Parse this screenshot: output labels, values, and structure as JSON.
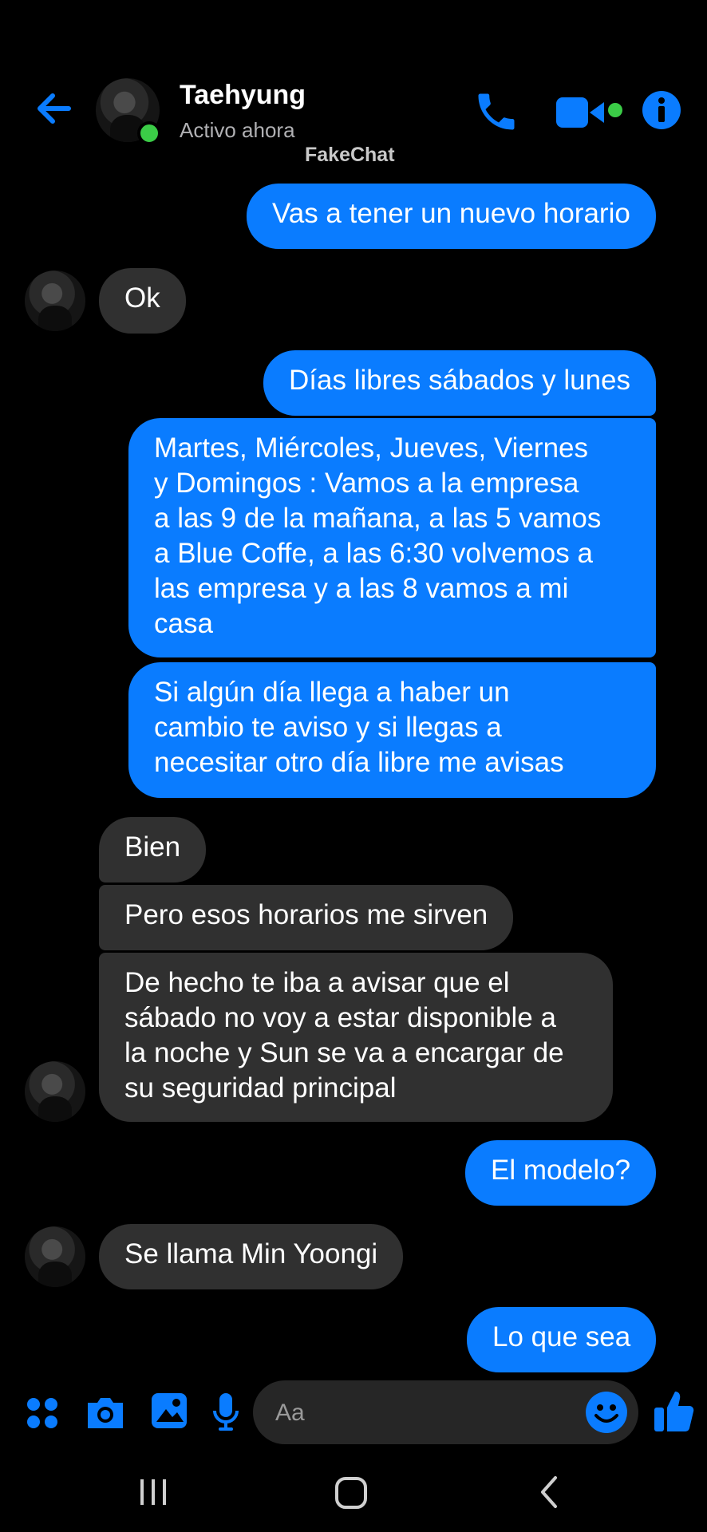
{
  "header": {
    "contact_name": "Taehyung",
    "status": "Activo ahora",
    "watermark": "FakeChat",
    "icons": [
      "back-arrow-icon",
      "phone-icon",
      "video-camera-icon",
      "info-icon"
    ]
  },
  "messages": [
    {
      "id": "m1",
      "side": "out",
      "text": "Vas a tener un nuevo horario"
    },
    {
      "id": "m2",
      "side": "in",
      "text": "Ok"
    },
    {
      "id": "m3",
      "side": "out",
      "text": "Días libres sábados y lunes"
    },
    {
      "id": "m4",
      "side": "out",
      "text": "Martes, Miércoles, Jueves, Viernes\ny Domingos : Vamos a la empresa\na las 9 de la mañana, a las 5 vamos\na Blue Coffe, a las 6:30 volvemos a\nlas empresa y a las 8 vamos a mi\ncasa"
    },
    {
      "id": "m5",
      "side": "out",
      "text": "Si algún día llega a haber un\ncambio te aviso y si llegas a\nnecesitar otro día libre me avisas"
    },
    {
      "id": "m6",
      "side": "in",
      "text": "Bien"
    },
    {
      "id": "m7",
      "side": "in",
      "text": "Pero esos horarios me sirven"
    },
    {
      "id": "m8",
      "side": "in",
      "text": "De hecho te iba a avisar que el\nsábado no voy a estar disponible a\nla noche y Sun se va a encargar de\nsu seguridad principal"
    },
    {
      "id": "m9",
      "side": "out",
      "text": "El modelo?"
    },
    {
      "id": "m10",
      "side": "in",
      "text": "Se llama Min Yoongi"
    },
    {
      "id": "m11",
      "side": "out",
      "text": "Lo que sea"
    }
  ],
  "composer": {
    "placeholder": "Aa",
    "icons": [
      "apps-grid-icon",
      "camera-icon",
      "gallery-icon",
      "microphone-icon",
      "emoji-icon",
      "thumbs-up-icon"
    ]
  },
  "colors": {
    "accent": "#0a7cff",
    "incoming_bubble": "#303030",
    "online": "#3bcc47",
    "background": "#000000"
  },
  "navbar": {
    "icons": [
      "recent-apps-icon",
      "home-icon",
      "back-icon"
    ]
  }
}
